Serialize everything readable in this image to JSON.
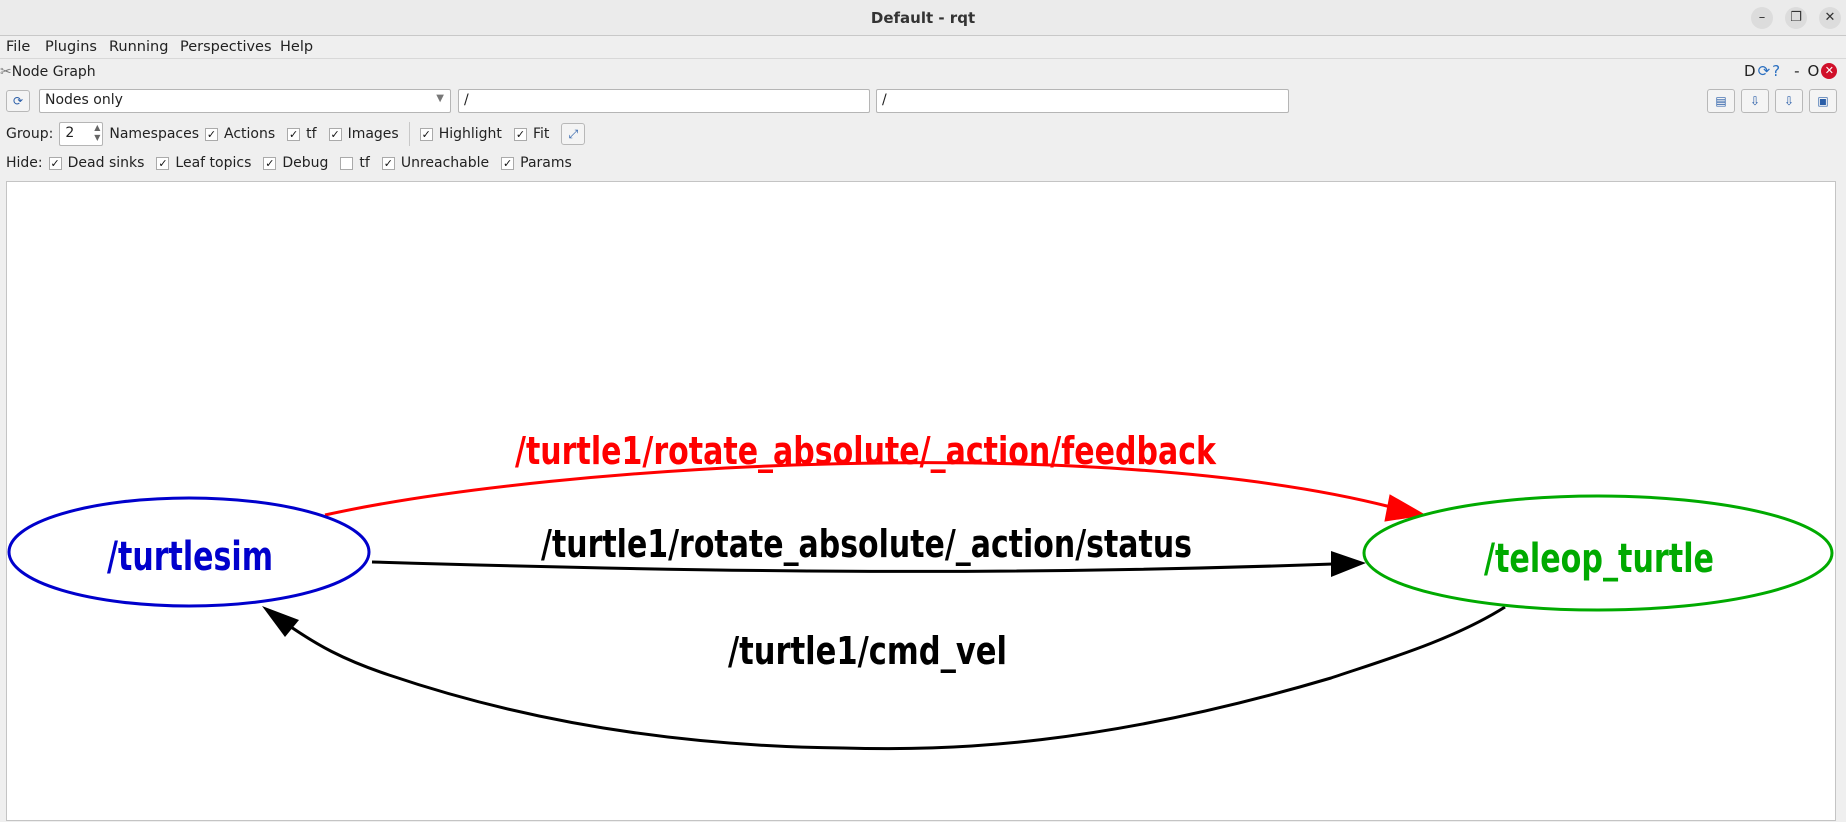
{
  "window": {
    "title": "Default - rqt",
    "controls": [
      "minimize",
      "restore",
      "close"
    ]
  },
  "menu": [
    {
      "label": "File"
    },
    {
      "label": "Plugins"
    },
    {
      "label": "Running"
    },
    {
      "label": "Perspectives"
    },
    {
      "label": "Help"
    }
  ],
  "plugin": {
    "title": "Node Graph",
    "right_labels": {
      "d": "D",
      "dash": "-",
      "o": "O"
    }
  },
  "toolbar": {
    "mode": "Nodes only",
    "filter1": "/",
    "filter2": "/"
  },
  "options": {
    "group_label": "Group:",
    "group_value": "2",
    "namespaces": "Namespaces",
    "checks": [
      {
        "label": "Actions",
        "checked": true
      },
      {
        "label": "tf",
        "checked": true
      },
      {
        "label": "Images",
        "checked": true
      },
      {
        "label": "Highlight",
        "checked": true
      },
      {
        "label": "Fit",
        "checked": true
      }
    ]
  },
  "hide": {
    "label": "Hide:",
    "checks": [
      {
        "label": "Dead sinks",
        "checked": true
      },
      {
        "label": "Leaf topics",
        "checked": true
      },
      {
        "label": "Debug",
        "checked": true
      },
      {
        "label": "tf",
        "checked": false
      },
      {
        "label": "Unreachable",
        "checked": true
      },
      {
        "label": "Params",
        "checked": true
      }
    ]
  },
  "graph": {
    "nodes": [
      {
        "name": "/turtlesim",
        "color": "#0000cc"
      },
      {
        "name": "/teleop_turtle",
        "color": "#00aa00"
      }
    ],
    "edges": [
      {
        "label": "/turtle1/rotate_absolute/_action/feedback",
        "from": "/turtlesim",
        "to": "/teleop_turtle",
        "color": "#ff0000"
      },
      {
        "label": "/turtle1/rotate_absolute/_action/status",
        "from": "/turtlesim",
        "to": "/teleop_turtle",
        "color": "#000000"
      },
      {
        "label": "/turtle1/cmd_vel",
        "from": "/teleop_turtle",
        "to": "/turtlesim",
        "color": "#000000"
      }
    ]
  }
}
